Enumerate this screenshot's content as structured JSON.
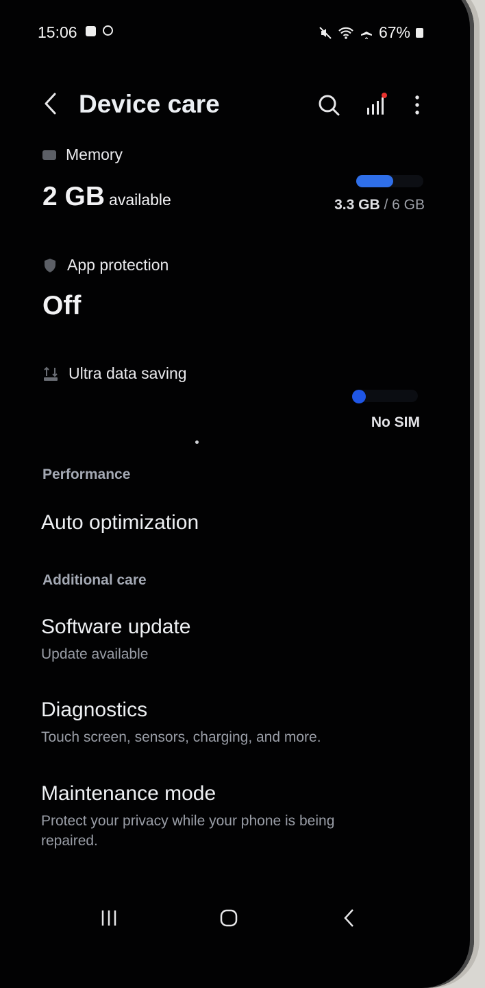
{
  "status": {
    "time": "15:06",
    "battery": "67%"
  },
  "header": {
    "title": "Device care"
  },
  "memory": {
    "label": "Memory",
    "value": "2 GB",
    "unit": "available",
    "used": "3.3 GB",
    "total": "/ 6 GB",
    "used_fraction": 0.55
  },
  "app_protection": {
    "label": "App protection",
    "value": "Off"
  },
  "data_saving": {
    "label": "Ultra data saving",
    "status": "No SIM"
  },
  "performance": {
    "heading": "Performance",
    "auto_optimization": "Auto optimization"
  },
  "additional": {
    "heading": "Additional care",
    "items": [
      {
        "title": "Software update",
        "subtitle": "Update available"
      },
      {
        "title": "Diagnostics",
        "subtitle": "Touch screen, sensors, charging, and more."
      },
      {
        "title": "Maintenance mode",
        "subtitle": "Protect your privacy while your phone is being repaired."
      }
    ]
  },
  "colors": {
    "accent": "#2f6fe9",
    "background": "#020203"
  }
}
